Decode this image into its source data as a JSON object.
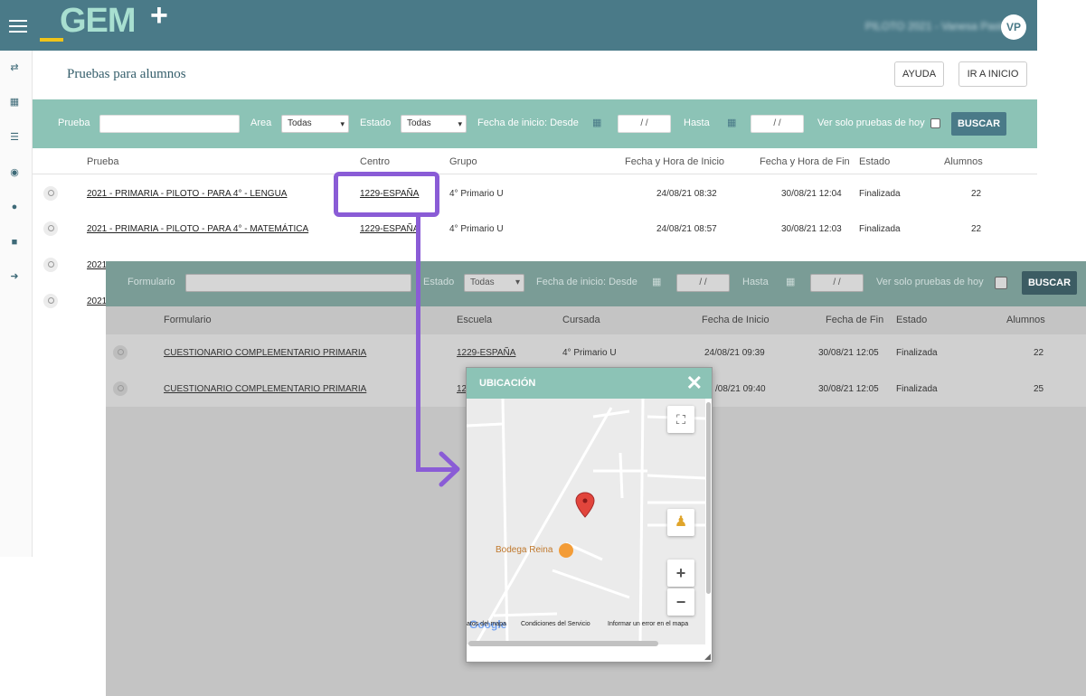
{
  "app": {
    "logo": "GEM",
    "user_name": "PILOTO 2021 - Vanesa Pastor",
    "avatar_initials": "VP"
  },
  "header": {
    "title": "Pruebas para alumnos",
    "help_label": "AYUDA",
    "home_label": "IR A INICIO"
  },
  "filters": {
    "prueba_label": "Prueba",
    "area_label": "Area",
    "area_value": "Todas",
    "estado_label": "Estado",
    "estado_value": "Todas",
    "desde_label": "Fecha de inicio: Desde",
    "desde_value": "/ /",
    "hasta_label": "Hasta",
    "hasta_value": "/ /",
    "today_label": "Ver solo pruebas de hoy",
    "search_label": "BUSCAR"
  },
  "table": {
    "columns": [
      "Prueba",
      "Centro",
      "Grupo",
      "Fecha y Hora de Inicio",
      "Fecha y Hora de Fin",
      "Estado",
      "Alumnos"
    ],
    "rows": [
      [
        "2021 - PRIMARIA - PILOTO - PARA 4° - LENGUA",
        "1229-ESPAÑA",
        "4° Primario U",
        "24/08/21 08:32",
        "30/08/21 12:04",
        "Finalizada",
        "22"
      ],
      [
        "2021 - PRIMARIA - PILOTO - PARA 4° - MATEMÁTICA",
        "1229-ESPAÑA",
        "4° Primario U",
        "24/08/21 08:57",
        "30/08/21 12:03",
        "Finalizada",
        "22"
      ],
      [
        "2021",
        "",
        "",
        "",
        "",
        "",
        ""
      ],
      [
        "2021",
        "",
        "",
        "",
        "",
        "",
        ""
      ]
    ]
  },
  "overlay": {
    "filters": {
      "formulario_label": "Formulario",
      "estado_label": "Estado",
      "estado_value": "Todas",
      "desde_label": "Fecha de inicio: Desde",
      "desde_value": "/ /",
      "hasta_label": "Hasta",
      "hasta_value": "/ /",
      "today_label": "Ver solo pruebas de hoy",
      "search_label": "BUSCAR"
    },
    "columns": [
      "Formulario",
      "Escuela",
      "Cursada",
      "Fecha de Inicio",
      "Fecha de Fin",
      "Estado",
      "Alumnos"
    ],
    "rows": [
      [
        "CUESTIONARIO COMPLEMENTARIO PRIMARIA",
        "1229-ESPAÑA",
        "4° Primario U",
        "24/08/21 09:39",
        "30/08/21 12:05",
        "Finalizada",
        "22"
      ],
      [
        "CUESTIONARIO COMPLEMENTARIO PRIMARIA",
        "12",
        "",
        "/08/21 09:40",
        "30/08/21 12:05",
        "Finalizada",
        "25"
      ]
    ]
  },
  "modal": {
    "title": "UBICACIÓN",
    "place_label": "Bodega Reina",
    "google": "Google",
    "footer_data": "atos del mapa",
    "footer_terms": "Condiciones del Servicio",
    "footer_report": "Informar un error en el mapa"
  }
}
